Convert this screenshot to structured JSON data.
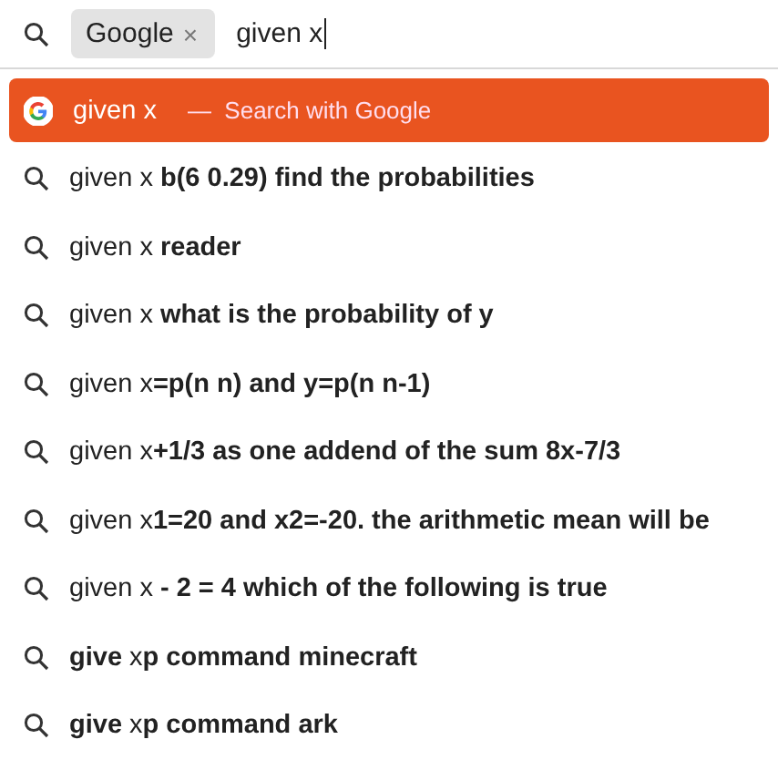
{
  "search_bar": {
    "engine_chip": {
      "label": "Google",
      "close": "×"
    },
    "value": "given x"
  },
  "suggestions": [
    {
      "kind": "engine",
      "selected": true,
      "text": "given x",
      "separator": "—",
      "action": "Search with Google"
    },
    {
      "kind": "suggestion",
      "selected": false,
      "text": "given x **b(6 0.29) find the probabilities**"
    },
    {
      "kind": "suggestion",
      "selected": false,
      "text": "given x **reader**"
    },
    {
      "kind": "suggestion",
      "selected": false,
      "text": "given x **what is the probability of y**"
    },
    {
      "kind": "suggestion",
      "selected": false,
      "text": "given x**=p(n n) and y=p(n n-1)**"
    },
    {
      "kind": "suggestion",
      "selected": false,
      "text": "given x**+1/3 as one addend of the sum 8x-7/3**"
    },
    {
      "kind": "suggestion",
      "selected": false,
      "text": "given x**1=20 and x2=-20. the arithmetic mean will be**"
    },
    {
      "kind": "suggestion",
      "selected": false,
      "text": "given x **- 2 = 4 which of the following is true**"
    },
    {
      "kind": "suggestion",
      "selected": false,
      "text": "**give** x**p command minecraft**"
    },
    {
      "kind": "suggestion",
      "selected": false,
      "text": "**give** x**p command ark**"
    }
  ]
}
